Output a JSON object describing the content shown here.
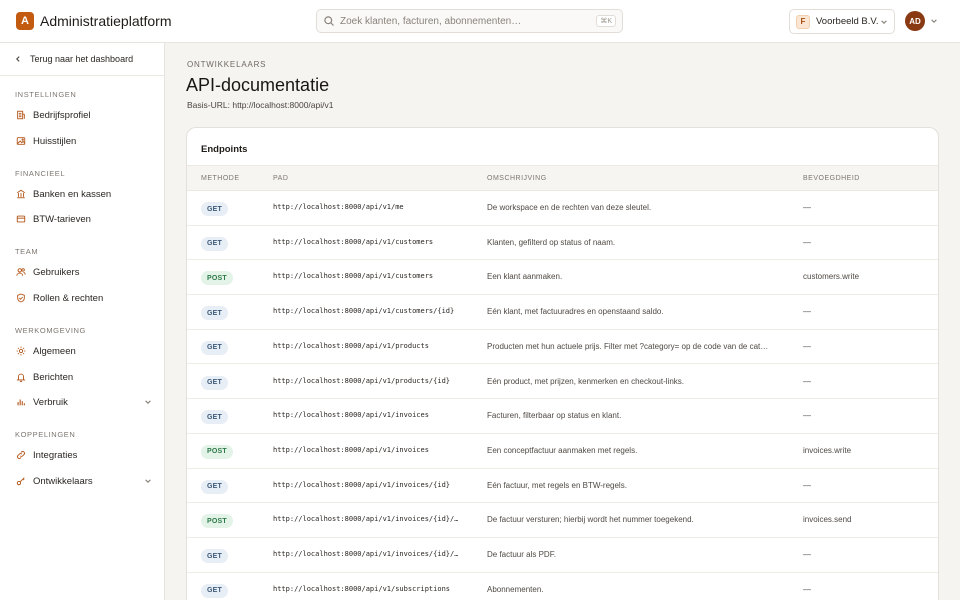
{
  "app": {
    "logo_letter": "A",
    "name": "Administratieplatform"
  },
  "search": {
    "placeholder": "Zoek klanten, facturen, abonnementen…",
    "shortcut": "⌘K"
  },
  "org": {
    "badge": "F",
    "name": "Voorbeeld B.V."
  },
  "user": {
    "initials": "AD"
  },
  "sidebar": {
    "back_label": "Terug naar het dashboard",
    "sections": [
      {
        "title": "INSTELLINGEN",
        "items": [
          {
            "label": "Bedrijfsprofiel",
            "icon": "building-doc-icon"
          },
          {
            "label": "Huisstijlen",
            "icon": "image-icon"
          }
        ]
      },
      {
        "title": "FINANCIEEL",
        "items": [
          {
            "label": "Banken en kassen",
            "icon": "bank-icon"
          },
          {
            "label": "BTW-tarieven",
            "icon": "card-icon"
          }
        ]
      },
      {
        "title": "TEAM",
        "items": [
          {
            "label": "Gebruikers",
            "icon": "users-icon"
          },
          {
            "label": "Rollen & rechten",
            "icon": "shield-icon"
          }
        ]
      },
      {
        "title": "WERKOMGEVING",
        "items": [
          {
            "label": "Algemeen",
            "icon": "sun-icon"
          },
          {
            "label": "Berichten",
            "icon": "bell-icon"
          },
          {
            "label": "Verbruik",
            "icon": "bar-chart-icon",
            "expandable": true
          }
        ]
      },
      {
        "title": "KOPPELINGEN",
        "items": [
          {
            "label": "Integraties",
            "icon": "link-icon"
          },
          {
            "label": "Ontwikkelaars",
            "icon": "key-icon",
            "expandable": true
          }
        ]
      }
    ]
  },
  "page": {
    "eyebrow": "ONTWIKKELAARS",
    "title": "API-documentatie",
    "base_url": "Basis-URL: http://localhost:8000/api/v1"
  },
  "endpoints": {
    "title": "Endpoints",
    "columns": {
      "method": "METHODE",
      "path": "PAD",
      "desc": "OMSCHRIJVING",
      "perm": "BEVOEGDHEID"
    },
    "rows": [
      {
        "method": "GET",
        "path": "http://localhost:8000/api/v1/me",
        "desc": "De workspace en de rechten van deze sleutel.",
        "perm": "—"
      },
      {
        "method": "GET",
        "path": "http://localhost:8000/api/v1/customers",
        "desc": "Klanten, gefilterd op status of naam.",
        "perm": "—"
      },
      {
        "method": "POST",
        "path": "http://localhost:8000/api/v1/customers",
        "desc": "Een klant aanmaken.",
        "perm": "customers.write"
      },
      {
        "method": "GET",
        "path": "http://localhost:8000/api/v1/customers/{id}",
        "desc": "Eén klant, met factuuradres en openstaand saldo.",
        "perm": "—"
      },
      {
        "method": "GET",
        "path": "http://localhost:8000/api/v1/products",
        "desc": "Producten met hun actuele prijs. Filter met ?category= op de code van de cat…",
        "perm": "—"
      },
      {
        "method": "GET",
        "path": "http://localhost:8000/api/v1/products/{id}",
        "desc": "Eén product, met prijzen, kenmerken en checkout-links.",
        "perm": "—"
      },
      {
        "method": "GET",
        "path": "http://localhost:8000/api/v1/invoices",
        "desc": "Facturen, filterbaar op status en klant.",
        "perm": "—"
      },
      {
        "method": "POST",
        "path": "http://localhost:8000/api/v1/invoices",
        "desc": "Een conceptfactuur aanmaken met regels.",
        "perm": "invoices.write"
      },
      {
        "method": "GET",
        "path": "http://localhost:8000/api/v1/invoices/{id}",
        "desc": "Eén factuur, met regels en BTW-regels.",
        "perm": "—"
      },
      {
        "method": "POST",
        "path": "http://localhost:8000/api/v1/invoices/{id}/…",
        "desc": "De factuur versturen; hierbij wordt het nummer toegekend.",
        "perm": "invoices.send"
      },
      {
        "method": "GET",
        "path": "http://localhost:8000/api/v1/invoices/{id}/…",
        "desc": "De factuur als PDF.",
        "perm": "—"
      },
      {
        "method": "GET",
        "path": "http://localhost:8000/api/v1/subscriptions",
        "desc": "Abonnementen.",
        "perm": "—"
      }
    ]
  },
  "colors": {
    "accent": "#c25a10",
    "get_badge_bg": "#e8eef5",
    "post_badge_bg": "#e3f3e8"
  }
}
